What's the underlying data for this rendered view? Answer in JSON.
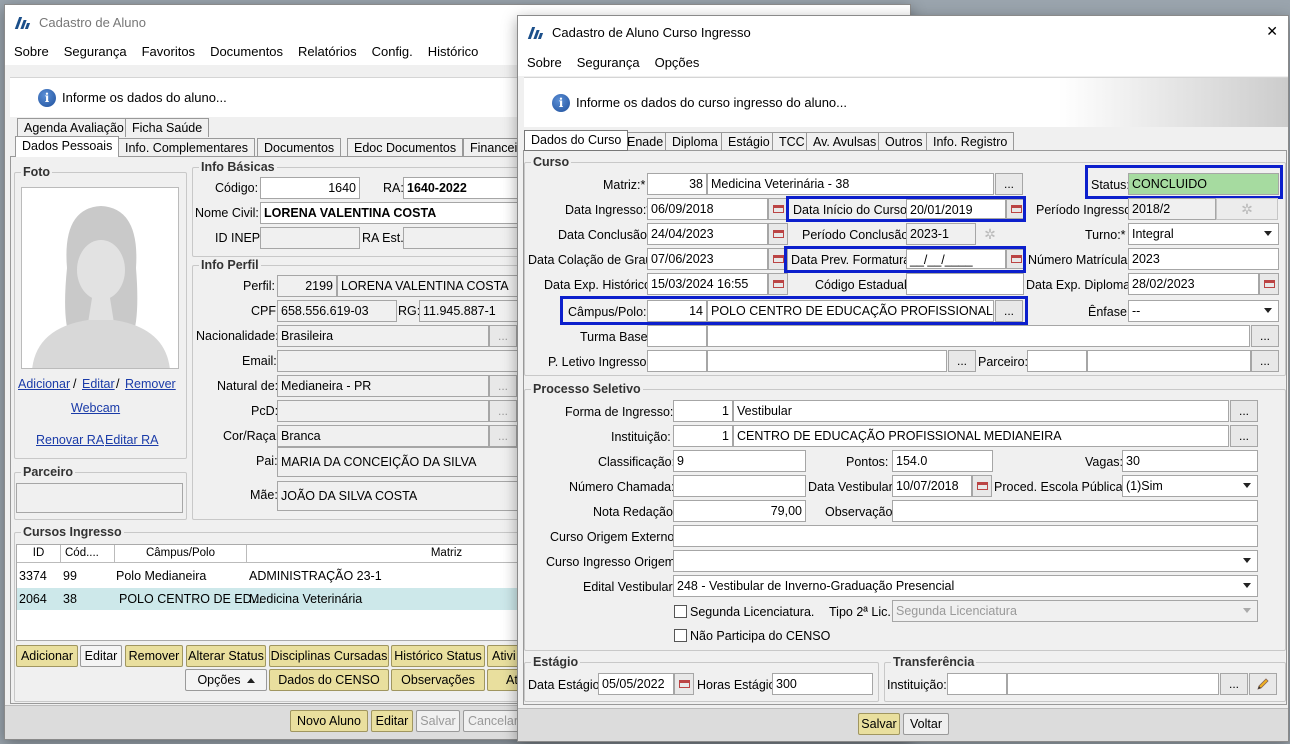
{
  "back_window": {
    "title": "Cadastro de Aluno",
    "menu": [
      "Sobre",
      "Segurança",
      "Favoritos",
      "Documentos",
      "Relatórios",
      "Config.",
      "Histórico"
    ],
    "info_text": "Informe os dados do aluno...",
    "tabs_row1": [
      "Agenda Avaliação",
      "Ficha Saúde"
    ],
    "tabs_row2": [
      "Dados Pessoais",
      "Info. Complementares",
      "Documentos",
      "Edoc Documentos",
      "Financeir"
    ],
    "foto": {
      "label": "Foto",
      "adicionar": "Adicionar",
      "editar": "Editar",
      "remover": "Remover",
      "separator": "/",
      "webcam": "Webcam",
      "renovar_ra": "Renovar RA",
      "editar_ra": "Editar RA"
    },
    "parceiro_label": "Parceiro",
    "info_basicas": {
      "label": "Info Básicas",
      "codigo_label": "Código:",
      "codigo": "1640",
      "ra_label": "RA:",
      "ra": "1640-2022",
      "nome_label": "Nome Civil:",
      "nome": "LORENA VALENTINA COSTA",
      "inep_label": "ID INEP:",
      "ra_est_label": "RA Est.:"
    },
    "info_perfil": {
      "label": "Info Perfil",
      "perfil_label": "Perfil:",
      "perfil_id": "2199",
      "perfil_nome": "LORENA VALENTINA COSTA",
      "cpf_label": "CPF:",
      "cpf": "658.556.619-03",
      "rg_label": "RG:",
      "rg": "11.945.887-1",
      "nac_label": "Nacionalidade:",
      "nac": "Brasileira",
      "email_label": "Email:",
      "natural_label": "Natural de:",
      "natural": "Medianeira - PR",
      "pcd_label": "PcD:",
      "cor_label": "Cor/Raça:",
      "cor": "Branca",
      "pai_label": "Pai:",
      "pai": "MARIA DA CONCEIÇÃO DA SILVA",
      "mae_label": "Mãe:",
      "mae": "JOÃO DA SILVA COSTA"
    },
    "cursos": {
      "label": "Cursos Ingresso",
      "headers": [
        "ID",
        "Cód....",
        "Câmpus/Polo",
        "Matriz"
      ],
      "rows": [
        {
          "id": "3374",
          "cod": "99",
          "campus": "Polo Medianeira",
          "matriz": "ADMINISTRAÇÃO 23-1"
        },
        {
          "id": "2064",
          "cod": "38",
          "campus": "POLO CENTRO DE ED...",
          "matriz": "Medicina Veterinária"
        }
      ]
    },
    "buttons_row1": [
      "Adicionar",
      "Editar",
      "Remover",
      "Alterar Status",
      "Disciplinas Cursadas",
      "Histórico Status",
      "Ativi"
    ],
    "buttons_row2": {
      "opcoes": "Opções",
      "censo": "Dados do CENSO",
      "obs": "Observações",
      "at": "At"
    },
    "footer": [
      "Novo Aluno",
      "Editar",
      "Salvar",
      "Cancelar"
    ]
  },
  "front_window": {
    "title": "Cadastro de Aluno Curso Ingresso",
    "close": "✕",
    "menu": [
      "Sobre",
      "Segurança",
      "Opções"
    ],
    "info_text": "Informe os dados do curso ingresso do aluno...",
    "tabs": [
      "Dados do Curso",
      "Enade",
      "Diploma",
      "Estágio",
      "TCC",
      "Av. Avulsas",
      "Outros",
      "Info. Registro"
    ],
    "curso": {
      "label": "Curso",
      "matriz_label": "Matriz:*",
      "matriz_id": "38",
      "matriz": "Medicina Veterinária - 38",
      "status_label": "Status:",
      "status": "CONCLUIDO",
      "data_ingresso_label": "Data Ingresso:*",
      "data_ingresso": "06/09/2018",
      "data_inicio_label": "Data Início do Curso:",
      "data_inicio": "20/01/2019",
      "periodo_ingresso_label": "Período Ingresso:",
      "periodo_ingresso": "2018/2",
      "data_conclusao_label": "Data Conclusão:",
      "data_conclusao": "24/04/2023",
      "periodo_conclusao_label": "Período Conclusão:",
      "periodo_conclusao": "2023-1",
      "turno_label": "Turno:*",
      "turno": "Integral",
      "data_colacao_label": "Data Colação de Grau:",
      "data_colacao": "07/06/2023",
      "data_prev_label": "Data Prev. Formatura:",
      "data_prev": "__/__/____",
      "num_matricula_label": "Número Matrícula:",
      "num_matricula": "2023",
      "data_exp_hist_label": "Data Exp. Histórico",
      "data_exp_hist": "15/03/2024 16:55",
      "codigo_estadual_label": "Código Estadual:",
      "data_exp_diploma_label": "Data Exp. Diploma:",
      "data_exp_diploma": "28/02/2023",
      "campus_label": "Câmpus/Polo:",
      "campus_id": "14",
      "campus": "POLO CENTRO DE EDUCAÇÃO PROFISSIONAL MEDIANEIRA",
      "enfase_label": "Ênfase:",
      "enfase": "--",
      "turma_base_label": "Turma Base:",
      "p_letivo_label": "P. Letivo Ingresso:",
      "parceiro_label": "Parceiro:"
    },
    "processo": {
      "label": "Processo Seletivo",
      "forma_label": "Forma de Ingresso:*",
      "forma_id": "1",
      "forma": "Vestibular",
      "inst_label": "Instituição:",
      "inst_id": "1",
      "inst": "CENTRO DE EDUCAÇÃO PROFISSIONAL MEDIANEIRA",
      "class_label": "Classificação:",
      "class": "9",
      "pontos_label": "Pontos:",
      "pontos": "154.0",
      "vagas_label": "Vagas:",
      "vagas": "30",
      "num_chamada_label": "Número Chamada:",
      "data_vest_label": "Data Vestibular:",
      "data_vest": "10/07/2018",
      "proced_label": "Proced. Escola Pública:*",
      "proced": "(1)Sim",
      "nota_label": "Nota Redação:",
      "nota": "79,00",
      "obs_label": "Observação:",
      "origem_ext_label": "Curso Origem Externo:",
      "origem_ing_label": "Curso Ingresso Origem:",
      "edital_label": "Edital Vestibular:",
      "edital": "248 - Vestibular de Inverno-Graduação Presencial",
      "segunda_label": "Segunda Licenciatura.",
      "tipo2_label": "Tipo 2ª Lic.:",
      "tipo2": "Segunda Licenciatura",
      "censo_label": "Não Participa do CENSO"
    },
    "estagio": {
      "label": "Estágio",
      "data_label": "Data Estágio:",
      "data": "05/05/2022",
      "horas_label": "Horas Estágio:",
      "horas": "300"
    },
    "transferencia": {
      "label": "Transferência",
      "inst_label": "Instituição:"
    },
    "footer": {
      "salvar": "Salvar",
      "voltar": "Voltar"
    },
    "colors": {
      "status_bg": "#a6dba0",
      "highlight": "#0c1fcc"
    }
  }
}
